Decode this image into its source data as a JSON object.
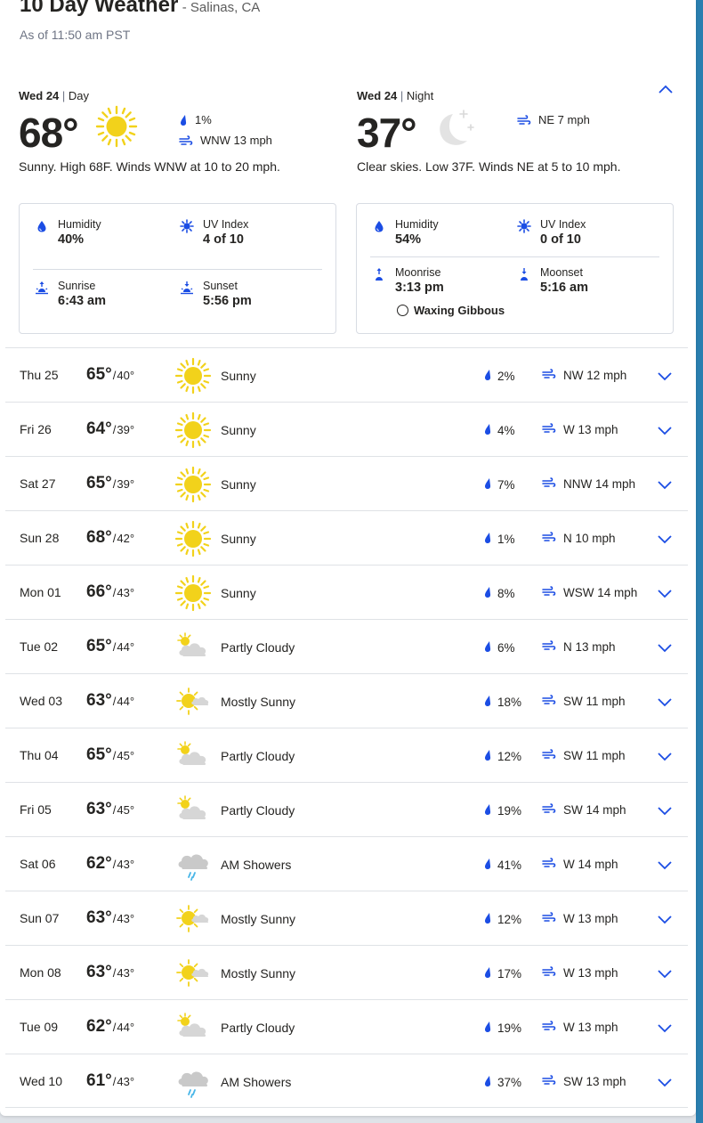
{
  "colors": {
    "accent": "#1b4de4",
    "sun": "#f2d21b",
    "cloud": "#d6d6d6",
    "rain": "#49b6e8",
    "text": "#252422"
  },
  "header": {
    "title": "10 Day Weather",
    "location": "- Salinas, CA",
    "as_of": "As of 11:50 am PST"
  },
  "today": {
    "day": {
      "label": "Wed 24",
      "sep": " | ",
      "part": "Day",
      "temp": "68°",
      "icon": "sun-icon",
      "precip": "1%",
      "wind": "WNW 13 mph",
      "narrative": "Sunny. High 68F. Winds WNW at 10 to 20 mph.",
      "humidity_label": "Humidity",
      "humidity": "40%",
      "uv_label": "UV Index",
      "uv": "4 of 10",
      "sunrise_label": "Sunrise",
      "sunrise": "6:43 am",
      "sunset_label": "Sunset",
      "sunset": "5:56 pm"
    },
    "night": {
      "label": "Wed 24",
      "sep": " | ",
      "part": "Night",
      "temp": "37°",
      "icon": "moon-icon",
      "wind": "NE 7 mph",
      "narrative": "Clear skies. Low 37F. Winds NE at 5 to 10 mph.",
      "humidity_label": "Humidity",
      "humidity": "54%",
      "uv_label": "UV Index",
      "uv": "0 of 10",
      "moonrise_label": "Moonrise",
      "moonrise": "3:13 pm",
      "moonset_label": "Moonset",
      "moonset": "5:16 am",
      "moon_phase": "Waxing Gibbous"
    }
  },
  "forecast": [
    {
      "date": "Thu 25",
      "hi": "65°",
      "lo": "40°",
      "icon": "sunny",
      "cond": "Sunny",
      "precip": "2%",
      "wind": "NW 12 mph"
    },
    {
      "date": "Fri 26",
      "hi": "64°",
      "lo": "39°",
      "icon": "sunny",
      "cond": "Sunny",
      "precip": "4%",
      "wind": "W 13 mph"
    },
    {
      "date": "Sat 27",
      "hi": "65°",
      "lo": "39°",
      "icon": "sunny",
      "cond": "Sunny",
      "precip": "7%",
      "wind": "NNW 14 mph"
    },
    {
      "date": "Sun 28",
      "hi": "68°",
      "lo": "42°",
      "icon": "sunny",
      "cond": "Sunny",
      "precip": "1%",
      "wind": "N 10 mph"
    },
    {
      "date": "Mon 01",
      "hi": "66°",
      "lo": "43°",
      "icon": "sunny",
      "cond": "Sunny",
      "precip": "8%",
      "wind": "WSW 14 mph"
    },
    {
      "date": "Tue 02",
      "hi": "65°",
      "lo": "44°",
      "icon": "partly-cloudy",
      "cond": "Partly Cloudy",
      "precip": "6%",
      "wind": "N 13 mph"
    },
    {
      "date": "Wed 03",
      "hi": "63°",
      "lo": "44°",
      "icon": "mostly-sunny",
      "cond": "Mostly Sunny",
      "precip": "18%",
      "wind": "SW 11 mph"
    },
    {
      "date": "Thu 04",
      "hi": "65°",
      "lo": "45°",
      "icon": "partly-cloudy",
      "cond": "Partly Cloudy",
      "precip": "12%",
      "wind": "SW 11 mph"
    },
    {
      "date": "Fri 05",
      "hi": "63°",
      "lo": "45°",
      "icon": "partly-cloudy",
      "cond": "Partly Cloudy",
      "precip": "19%",
      "wind": "SW 14 mph"
    },
    {
      "date": "Sat 06",
      "hi": "62°",
      "lo": "43°",
      "icon": "showers",
      "cond": "AM Showers",
      "precip": "41%",
      "wind": "W 14 mph"
    },
    {
      "date": "Sun 07",
      "hi": "63°",
      "lo": "43°",
      "icon": "mostly-sunny",
      "cond": "Mostly Sunny",
      "precip": "12%",
      "wind": "W 13 mph"
    },
    {
      "date": "Mon 08",
      "hi": "63°",
      "lo": "43°",
      "icon": "mostly-sunny",
      "cond": "Mostly Sunny",
      "precip": "17%",
      "wind": "W 13 mph"
    },
    {
      "date": "Tue 09",
      "hi": "62°",
      "lo": "44°",
      "icon": "partly-cloudy",
      "cond": "Partly Cloudy",
      "precip": "19%",
      "wind": "W 13 mph"
    },
    {
      "date": "Wed 10",
      "hi": "61°",
      "lo": "43°",
      "icon": "showers",
      "cond": "AM Showers",
      "precip": "37%",
      "wind": "SW 13 mph"
    }
  ]
}
